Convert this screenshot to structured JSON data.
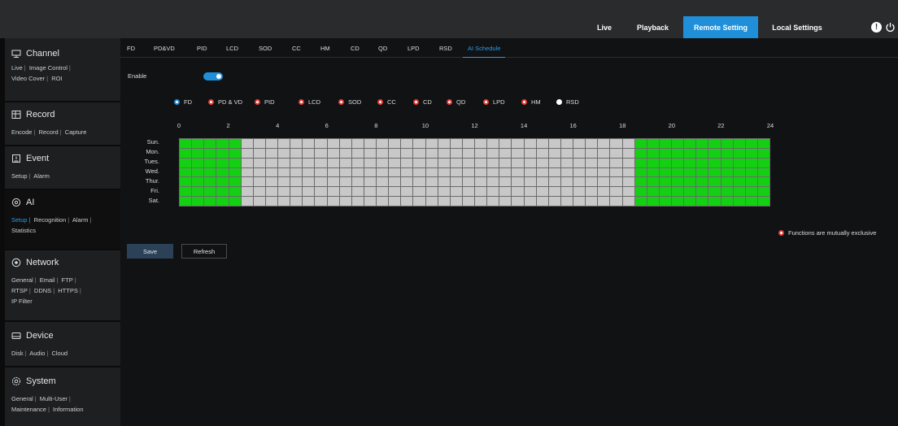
{
  "topnav": {
    "items": [
      "Live",
      "Playback",
      "Remote Setting",
      "Local Settings"
    ],
    "active": "Remote Setting"
  },
  "sidebar": {
    "sections": [
      {
        "title": "Channel",
        "icon": "channel-icon",
        "links": [
          "Live",
          "Image Control",
          "Video Cover",
          "ROI"
        ]
      },
      {
        "title": "Record",
        "icon": "record-icon",
        "links": [
          "Encode",
          "Record",
          "Capture"
        ]
      },
      {
        "title": "Event",
        "icon": "event-icon",
        "links": [
          "Setup",
          "Alarm"
        ]
      },
      {
        "title": "AI",
        "icon": "ai-icon",
        "links": [
          "Setup",
          "Recognition",
          "Alarm",
          "Statistics"
        ],
        "selected": "Setup"
      },
      {
        "title": "Network",
        "icon": "network-icon",
        "links": [
          "General",
          "Email",
          "FTP",
          "RTSP",
          "DDNS",
          "HTTPS",
          "IP Filter"
        ]
      },
      {
        "title": "Device",
        "icon": "device-icon",
        "links": [
          "Disk",
          "Audio",
          "Cloud"
        ]
      },
      {
        "title": "System",
        "icon": "system-icon",
        "links": [
          "General",
          "Multi-User",
          "Maintenance",
          "Information"
        ]
      }
    ]
  },
  "tabs": {
    "items": [
      "FD",
      "PD&VD",
      "PID",
      "LCD",
      "SOD",
      "CC",
      "HM",
      "CD",
      "QD",
      "LPD",
      "RSD",
      "AI Schedule"
    ],
    "active": "AI Schedule"
  },
  "enable": {
    "label": "Enable",
    "on": true
  },
  "functions": [
    {
      "label": "FD",
      "style": "blue"
    },
    {
      "label": "PD & VD",
      "style": "red"
    },
    {
      "label": "PID",
      "style": "red"
    },
    {
      "label": "LCD",
      "style": "red"
    },
    {
      "label": "SOD",
      "style": "red"
    },
    {
      "label": "CC",
      "style": "red"
    },
    {
      "label": "CD",
      "style": "red"
    },
    {
      "label": "QD",
      "style": "red"
    },
    {
      "label": "LPD",
      "style": "red"
    },
    {
      "label": "HM",
      "style": "red"
    },
    {
      "label": "RSD",
      "style": "white"
    }
  ],
  "schedule": {
    "hours": [
      "0",
      "2",
      "4",
      "6",
      "8",
      "10",
      "12",
      "14",
      "16",
      "18",
      "20",
      "22",
      "24"
    ],
    "days": [
      "Sun.",
      "Mon.",
      "Tues.",
      "Wed.",
      "Thur.",
      "Fri.",
      "Sat."
    ],
    "active_ranges_hours": [
      [
        0,
        2.5
      ],
      [
        18.5,
        24
      ]
    ]
  },
  "note": "Functions are mutually exclusive",
  "buttons": {
    "save": "Save",
    "refresh": "Refresh"
  },
  "colors": {
    "accent": "#1e8fd8",
    "active_cell": "#13d013",
    "inactive_cell": "#c8c8c8",
    "exclusive_dot": "#e53935"
  }
}
